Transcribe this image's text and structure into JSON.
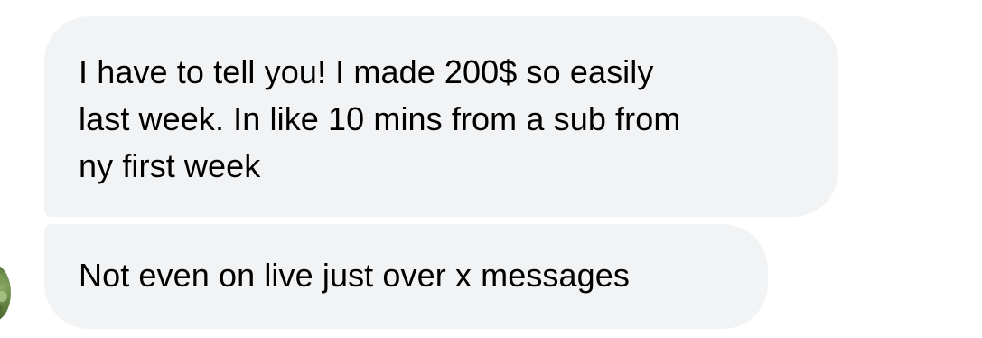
{
  "messages": [
    {
      "text": "I have to tell you! I made 200$ so easily\nlast week. In like 10 mins from a sub from\nny first week"
    },
    {
      "text": "Not even on live just over x messages"
    }
  ],
  "colors": {
    "bubble_background": "#f2f3f5",
    "text": "#000000",
    "page_background": "#ffffff"
  }
}
